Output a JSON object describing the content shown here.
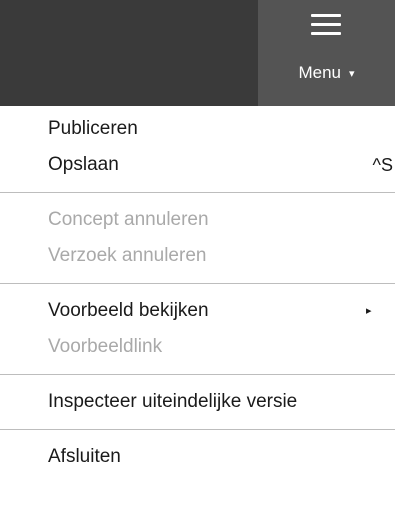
{
  "toolbar": {
    "menu_label": "Menu",
    "menu_caret": "▾",
    "menu_icon": "hamburger-icon"
  },
  "menu": {
    "publish": "Publiceren",
    "save": "Opslaan",
    "save_shortcut": "^S",
    "cancel_draft": "Concept annuleren",
    "cancel_request": "Verzoek annuleren",
    "preview": "Voorbeeld bekijken",
    "preview_arrow": "▸",
    "preview_link": "Voorbeeldlink",
    "inspect_final": "Inspecteer uiteindelijke versie",
    "close": "Afsluiten"
  },
  "colors": {
    "topbar": "#3a3a3a",
    "menu_button": "#545454",
    "text": "#1a1a1a",
    "disabled_text": "#a9a9a9",
    "separator": "#bdbdbd"
  }
}
